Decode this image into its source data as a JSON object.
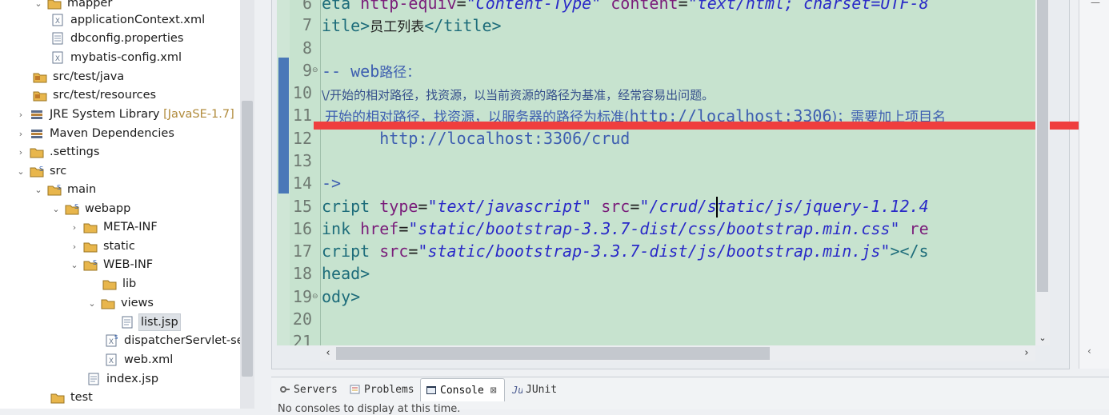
{
  "explorer": {
    "items": [
      {
        "label": "mapper",
        "level": 3,
        "type": "folder",
        "twisty": "expanded"
      },
      {
        "label": "applicationContext.xml",
        "level": 4,
        "type": "xml"
      },
      {
        "label": "dbconfig.properties",
        "level": 4,
        "type": "file"
      },
      {
        "label": "mybatis-config.xml",
        "level": 4,
        "type": "xml"
      },
      {
        "label": "src/test/java",
        "level": 2,
        "type": "source-folder"
      },
      {
        "label": "src/test/resources",
        "level": 2,
        "type": "source-folder"
      },
      {
        "label": "JRE System Library",
        "decoration": "[JavaSE-1.7]",
        "level": 1,
        "type": "library",
        "twisty": "collapsed"
      },
      {
        "label": "Maven Dependencies",
        "level": 1,
        "type": "library",
        "twisty": "collapsed"
      },
      {
        "label": ".settings",
        "level": 1,
        "type": "folder",
        "twisty": "collapsed"
      },
      {
        "label": "src",
        "level": 1,
        "type": "folder",
        "twisty": "expanded"
      },
      {
        "label": "main",
        "level": 2,
        "type": "folder",
        "twisty": "expanded"
      },
      {
        "label": "webapp",
        "level": 3,
        "type": "folder",
        "twisty": "expanded"
      },
      {
        "label": "META-INF",
        "level": 4,
        "type": "folder",
        "twisty": "collapsed"
      },
      {
        "label": "static",
        "level": 4,
        "type": "folder",
        "twisty": "collapsed"
      },
      {
        "label": "WEB-INF",
        "level": 4,
        "type": "folder",
        "twisty": "expanded"
      },
      {
        "label": "lib",
        "level": 5,
        "type": "folder"
      },
      {
        "label": "views",
        "level": 5,
        "type": "folder",
        "twisty": "expanded"
      },
      {
        "label": "list.jsp",
        "level": 6,
        "type": "jsp",
        "selected": true
      },
      {
        "label": "dispatcherServlet-ser",
        "level": 5,
        "type": "xml"
      },
      {
        "label": "web.xml",
        "level": 5,
        "type": "xml"
      },
      {
        "label": "index.jsp",
        "level": 4,
        "type": "jsp"
      },
      {
        "label": "test",
        "level": 2,
        "type": "folder"
      }
    ]
  },
  "editor": {
    "line_numbers": [
      "6",
      "7",
      "8",
      "9",
      "10",
      "11",
      "12",
      "13",
      "14",
      "15",
      "16",
      "17",
      "18",
      "19",
      "20",
      "21"
    ],
    "lines": {
      "l6": {
        "a": "eta ",
        "b": "http-equiv",
        "c": "=",
        "d": "\"Content-Type\"",
        "e": " ",
        "f": "content",
        "g": "=",
        "h": "\"text/html; charset=UTF-8"
      },
      "l7": {
        "a": "itle>",
        "b": "员工列表",
        "c": "</title>"
      },
      "l9": {
        "a": "-- web",
        "b": "路径："
      },
      "l10": {
        "text": "\\/开始的相对路径，找资源，以当前资源的路径为基准，经常容易出问题。"
      },
      "l11": {
        "a": "开始的相对路径，找资源，以服务器的路径为标准(",
        "b": "http://localhost:3306",
        "c": ")；需要加上项目名"
      },
      "l12": {
        "text": "      http://localhost:3306/crud"
      },
      "l14": {
        "text": "->"
      },
      "l15": {
        "a": "cript ",
        "b": "type",
        "c": "=",
        "d": "\"text/javascript\"",
        "e": " ",
        "f": "src",
        "g": "=",
        "h": "\"/crud/static/js/jquery-1.12.4"
      },
      "l16": {
        "a": "ink ",
        "b": "href",
        "c": "=",
        "d": "\"static/bootstrap-3.3.7-dist/css/bootstrap.min.css\"",
        "e": " re"
      },
      "l17": {
        "a": "cript ",
        "b": "src",
        "c": "=",
        "d": "\"static/bootstrap-3.3.7-dist/js/bootstrap.min.js\"",
        "e": "></s"
      },
      "l18": {
        "text": "head>"
      },
      "l19": {
        "text": "ody>"
      }
    }
  },
  "bottom_tabs": [
    {
      "label": "Servers",
      "icon": "servers-icon"
    },
    {
      "label": "Problems",
      "icon": "problems-icon"
    },
    {
      "label": "Console",
      "icon": "console-icon",
      "active": true
    },
    {
      "label": "JUnit",
      "icon": "junit-icon"
    }
  ],
  "console_text": "No consoles to display at this time.",
  "colors": {
    "editor_bg": "#c7e3cf",
    "annotation_line": "#ef3e3e",
    "tag": "#1d6c7a",
    "attribute": "#7a1d7a",
    "string": "#2a2ac8"
  }
}
